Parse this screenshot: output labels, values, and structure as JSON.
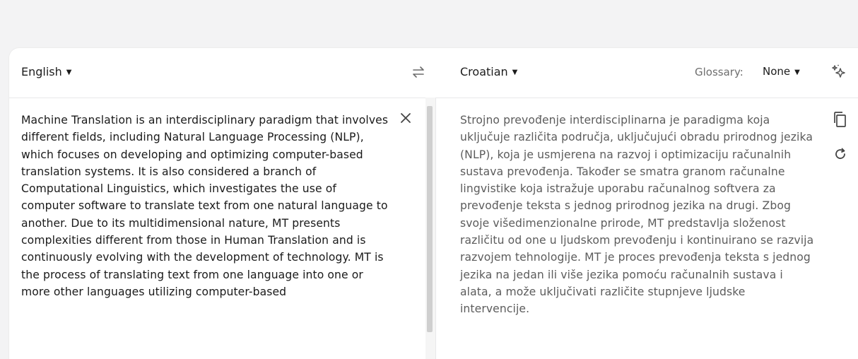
{
  "header": {
    "source_language": "English",
    "target_language": "Croatian",
    "glossary_label": "Glossary:",
    "glossary_value": "None",
    "caret": "▼"
  },
  "icons": {
    "swap": "swap-languages-icon",
    "magic": "sparkle-icon",
    "clear": "close-icon",
    "copy": "copy-icon",
    "regenerate": "refresh-icon"
  },
  "source": {
    "text": "Machine Translation is an interdisciplinary paradigm that involves different fields, including Natural Language Processing (NLP), which focuses on developing and optimizing computer-based translation systems. It is also considered a branch of Computational Linguistics, which investigates the use of computer software to translate text from one natural language to another. Due to its multidimensional nature, MT presents complexities different from those in Human Translation and is continuously evolving with the development of technology. MT is the process of translating text from one language into one or more other languages utilizing computer-based"
  },
  "target": {
    "text": "Strojno prevođenje interdisciplinarna je paradigma koja uključuje različita područja, uključujući obradu prirodnog jezika (NLP), koja je usmjerena na razvoj i optimizaciju računalnih sustava prevođenja. Također se smatra granom računalne lingvistike koja istražuje uporabu računalnog softvera za prevođenje teksta s jednog prirodnog jezika na drugi. Zbog svoje višedimenzionalne prirode, MT predstavlja složenost različitu od one u ljudskom prevođenju i kontinuirano se razvija razvojem tehnologije. MT je proces prevođenja teksta s jednog jezika na jedan ili više jezika pomoću računalnih sustava i alata, a može uključivati različite stupnjeve ljudske intervencije."
  }
}
